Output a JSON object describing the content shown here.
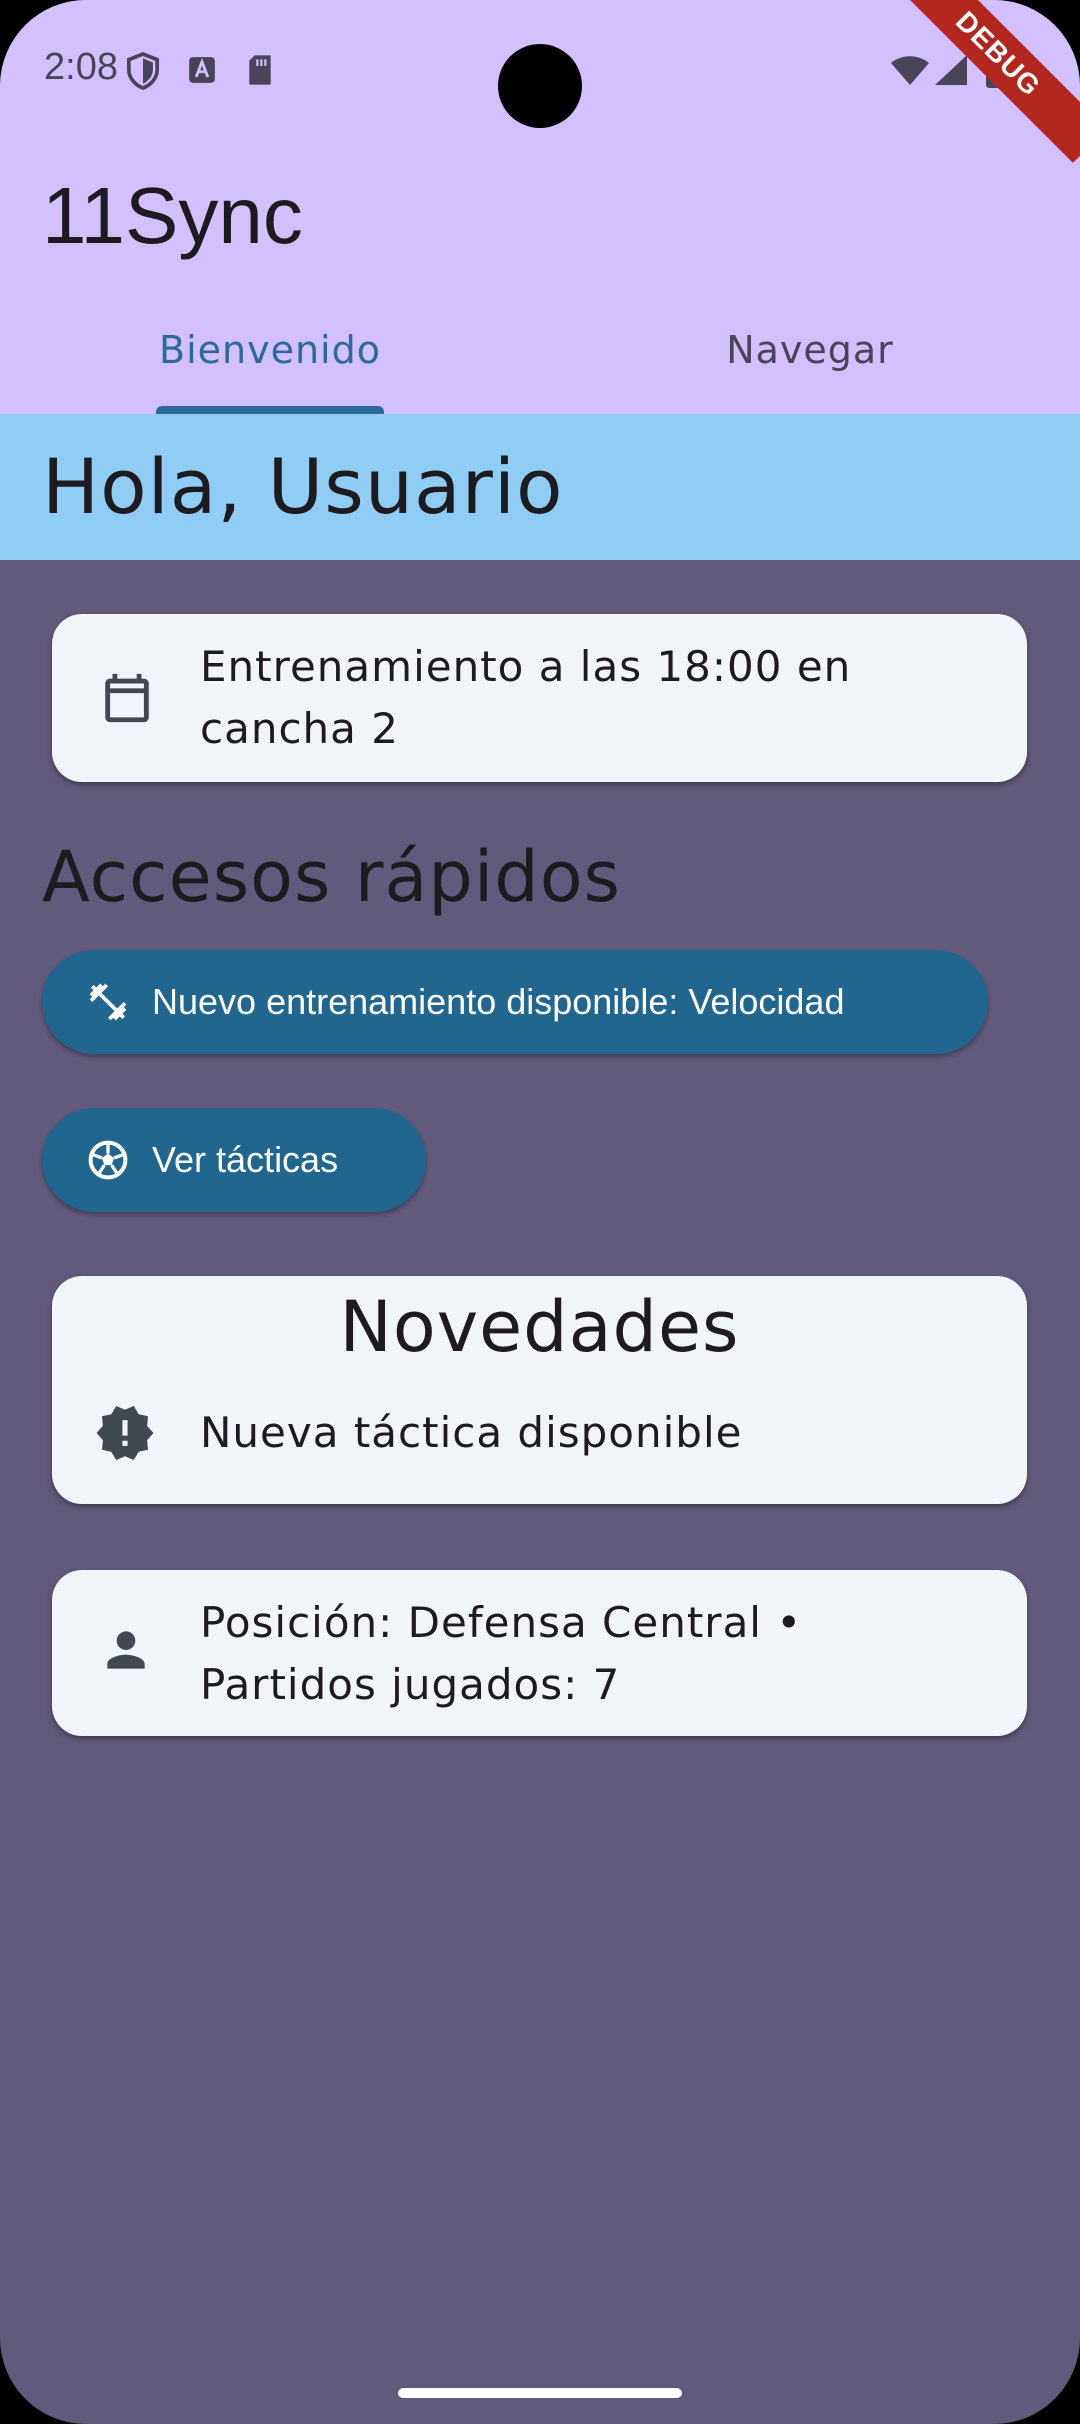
{
  "status_bar": {
    "time": "2:08",
    "icons": [
      "shield-icon",
      "text-a-icon",
      "sd-card-icon",
      "wifi-icon",
      "signal-icon",
      "battery-icon"
    ],
    "debug_banner": "DEBUG"
  },
  "app_bar": {
    "title": "11Sync",
    "tabs": [
      {
        "label": "Bienvenido",
        "selected": true
      },
      {
        "label": "Navegar",
        "selected": false
      }
    ]
  },
  "greeting": "Hola, Usuario",
  "next_event": {
    "icon": "calendar-icon",
    "text_line1": "Entrenamiento a las 18:00 en",
    "text_line2": "cancha 2"
  },
  "quick_access": {
    "title": "Accesos rápidos",
    "buttons": [
      {
        "label": "Nuevo entrenamiento disponible: Velocidad",
        "icon": "fitness-icon"
      },
      {
        "label": "Ver tácticas",
        "icon": "soccer-ball-icon"
      }
    ]
  },
  "news": {
    "title": "Novedades",
    "items": [
      {
        "icon": "new-releases-icon",
        "text": "Nueva táctica disponible"
      }
    ]
  },
  "player_info": {
    "icon": "person-icon",
    "text_line1": "Posición: Defensa Central •",
    "text_line2": "Partidos jugados: 7"
  },
  "colors": {
    "app_bar": "#D3C0FF",
    "greeting_bg": "#90CDF4",
    "body_bg": "#625A7C",
    "card_bg": "#F1F4F9",
    "button_bg": "#21668E",
    "tab_selected": "#2B6A9A"
  }
}
